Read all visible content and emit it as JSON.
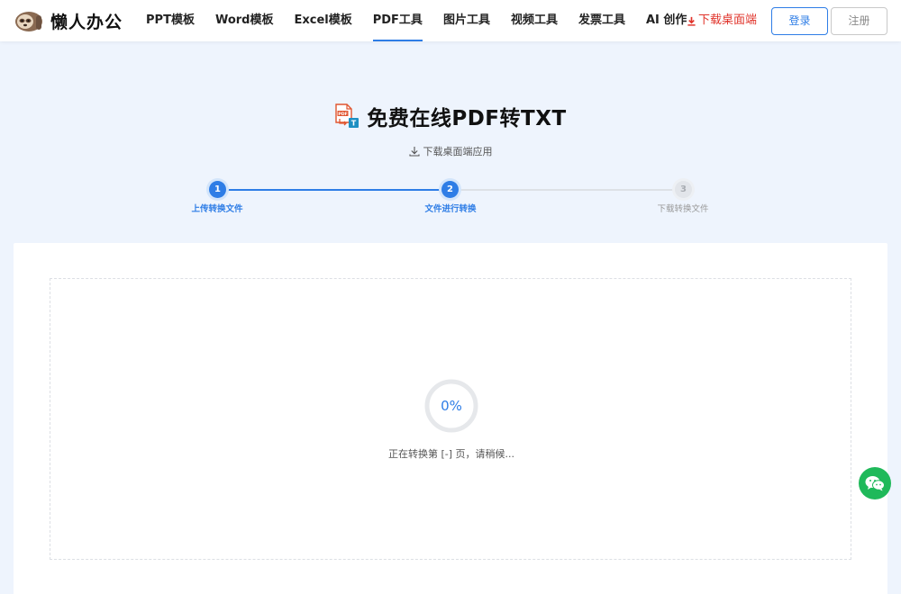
{
  "header": {
    "logo_text": "懒人办公",
    "nav": [
      {
        "label": "PPT模板"
      },
      {
        "label": "Word模板"
      },
      {
        "label": "Excel模板"
      },
      {
        "label": "PDF工具",
        "active": true
      },
      {
        "label": "图片工具"
      },
      {
        "label": "视频工具"
      },
      {
        "label": "发票工具"
      },
      {
        "label": "AI 创作"
      }
    ],
    "download_label": "下载桌面端",
    "login_label": "登录",
    "register_label": "注册"
  },
  "hero": {
    "icon": "pdf-to-txt-icon",
    "title": "免费在线PDF转TXT",
    "desktop_link": "下载桌面端应用"
  },
  "steps": [
    {
      "number": "1",
      "label": "上传转换文件",
      "state": "done"
    },
    {
      "number": "2",
      "label": "文件进行转换",
      "state": "done"
    },
    {
      "number": "3",
      "label": "下载转换文件",
      "state": "todo"
    }
  ],
  "conversion": {
    "progress_percent": 0,
    "progress_label": "0%",
    "status": "正在转换第 [-] 页，请稍候..."
  },
  "floating": {
    "icon": "wechat-icon"
  },
  "colors": {
    "accent": "#2e7de6",
    "download": "#e0332a",
    "background": "#eef4fd",
    "wechat": "#1fb95a"
  }
}
